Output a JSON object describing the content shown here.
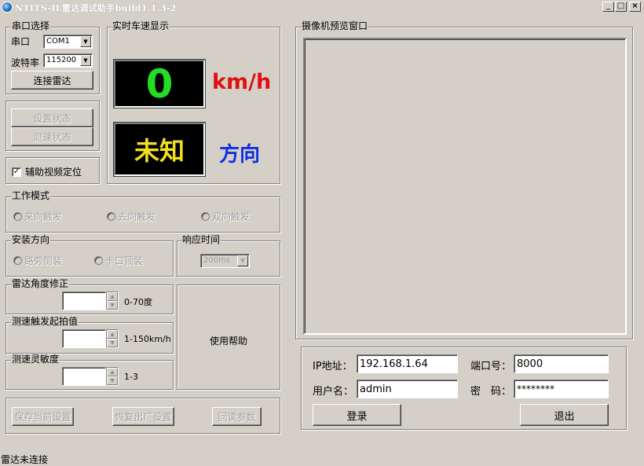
{
  "window": {
    "title": "NTITS-IL雷达调试助手build1.1.3-2",
    "minimize": "_",
    "maximize": "□",
    "close": "×"
  },
  "serial": {
    "group_label": "串口选择",
    "port_label": "串口",
    "port_value": "COM1",
    "baud_label": "波特率",
    "baud_value": "115200",
    "connect_button": "连接雷达"
  },
  "status_buttons": {
    "set_status": "设置状态",
    "speed_status": "测速状态"
  },
  "video_assist": {
    "label": "辅助视频定位",
    "checked": "✓"
  },
  "speed_display": {
    "group_label": "实时车速显示",
    "speed_value": "0",
    "speed_unit": "km/h",
    "direction_value": "未知",
    "direction_label": "方向",
    "colors": {
      "speed": "#22dd22",
      "unit": "#e01010",
      "direction_value": "#f0e020",
      "direction_label": "#1030e0"
    }
  },
  "work_mode": {
    "group_label": "工作模式",
    "options": [
      "来向触发",
      "去向触发",
      "双向触发"
    ]
  },
  "install_dir": {
    "group_label": "安装方向",
    "options": [
      "路旁侧装",
      "卡口顶装"
    ]
  },
  "response_time": {
    "group_label": "响应时间",
    "value": "200ms"
  },
  "angle": {
    "group_label": "雷达角度修正",
    "range": "0-70度",
    "value": ""
  },
  "trigger": {
    "group_label": "测速触发起拍值",
    "range": "1-150km/h",
    "value": ""
  },
  "sensitivity": {
    "group_label": "测速灵敏度",
    "range": "1-3",
    "value": ""
  },
  "help_text": "使用帮助",
  "bottom_buttons": {
    "save": "保存当前设置",
    "restore": "恢复出厂设置",
    "read": "回读参数"
  },
  "camera": {
    "group_label": "摄像机预览窗口",
    "ip_label": "IP地址：",
    "ip_value": "192.168.1.64",
    "port_label": "端口号：",
    "port_value": "8000",
    "user_label": "用户名：",
    "user_value": "admin",
    "password_label": "密　码：",
    "password_value": "********",
    "login_button": "登录",
    "logout_button": "退出"
  },
  "statusbar": {
    "text": "雷达未连接"
  }
}
